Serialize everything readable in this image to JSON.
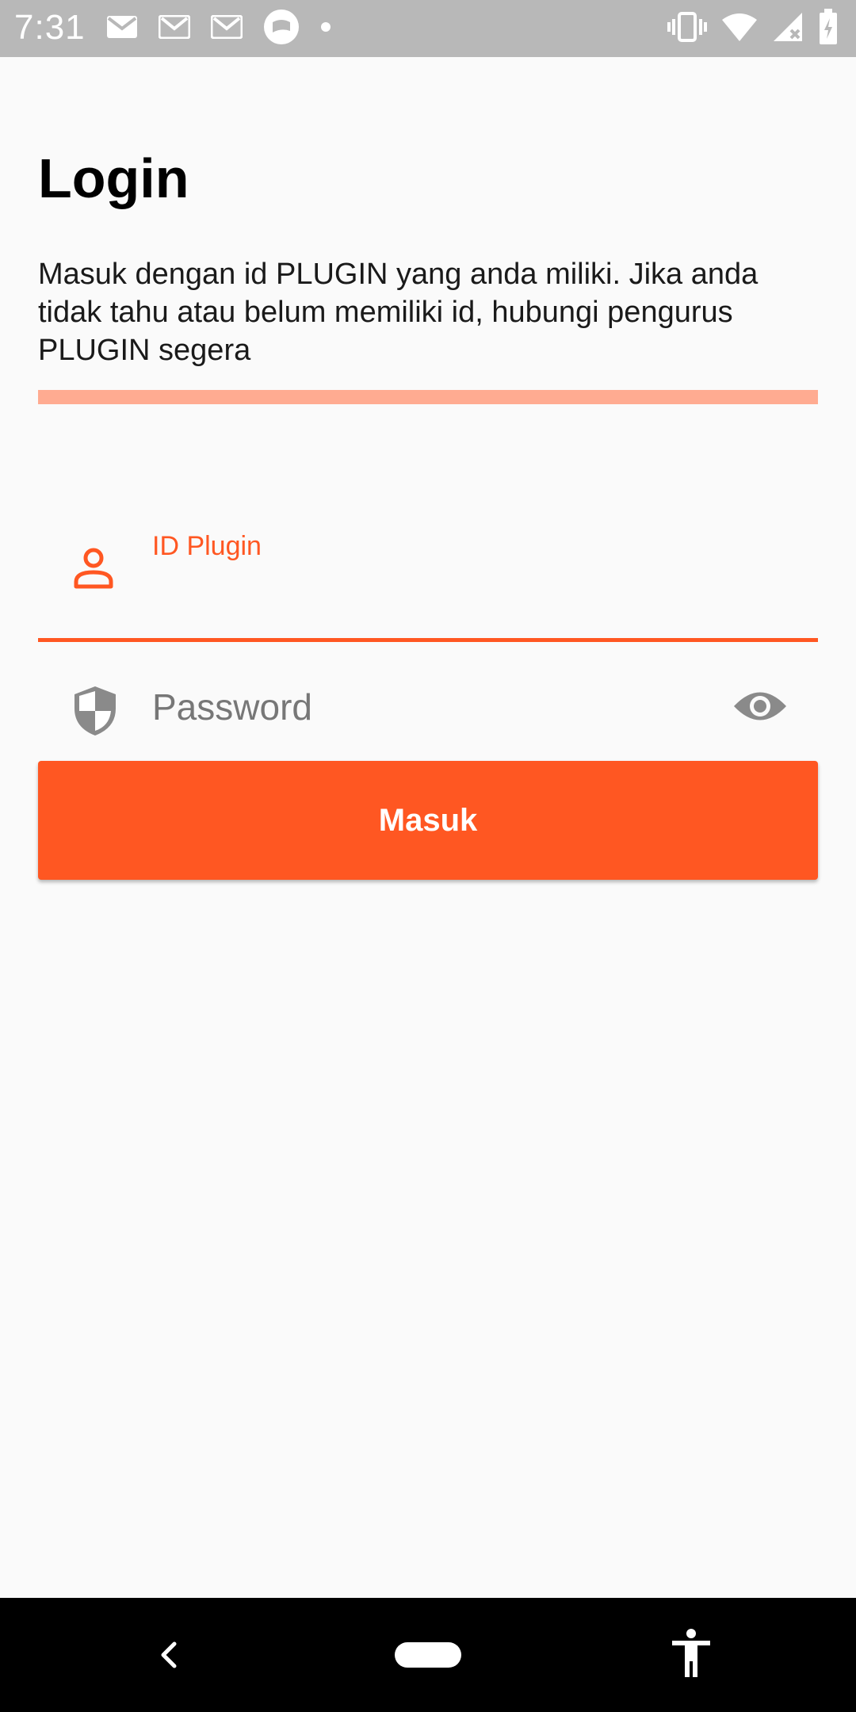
{
  "status_bar": {
    "time": "7:31",
    "left_icons": [
      "gmail-icon",
      "gmail-icon",
      "gmail-icon",
      "chat-bubble-icon",
      "dot-icon"
    ],
    "right_icons": [
      "vibrate-icon",
      "wifi-icon",
      "signal-icon",
      "battery-icon"
    ]
  },
  "login": {
    "title": "Login",
    "description": "Masuk dengan id PLUGIN yang anda miliki. Jika anda tidak tahu atau belum memiliki id, hubungi pengurus PLUGIN segera",
    "progress_color": "#FFAB91",
    "progress_fill": 0
  },
  "form": {
    "id_field": {
      "label": "ID Plugin",
      "value": "",
      "icon": "person-icon",
      "accent": "#FF5722"
    },
    "password_field": {
      "placeholder": "Password",
      "value": "",
      "icon": "shield-icon",
      "toggle_icon": "eye-icon"
    },
    "submit_label": "Masuk"
  },
  "theme": {
    "primary": "#FF5722",
    "background": "#FAFAFA",
    "status_bar": "#B8B8B8",
    "nav_bar": "#000000"
  },
  "nav_bar": {
    "buttons": [
      "back-icon",
      "home-pill-icon",
      "accessibility-icon"
    ]
  }
}
